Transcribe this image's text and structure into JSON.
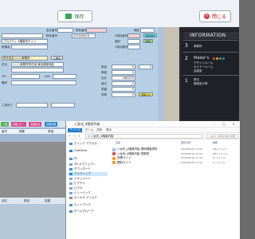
{
  "toolbar": {
    "save_label": "保存",
    "close_label": "閉じる"
  },
  "form": {
    "labels": [
      "会社番号",
      "物件番号",
      "補記",
      "物件番号",
      "3項目番号",
      "補記",
      "3項目番号",
      "現場名",
      "物件名",
      "株式会社○○○事務所",
      "担当",
      "TEL",
      "FAX",
      "備考",
      "工事完了",
      "工事名",
      "見積",
      "合計",
      "数量",
      "単価",
      "値引",
      "税額"
    ],
    "values": {
      "company_code": "",
      "date1": "2020/06/19",
      "property_name": "プロパティ 4階案内サイン",
      "client": "株式会社○○○事務所",
      "person": "山田",
      "address": "○○○事務所所在地 東京都新宿区",
      "amount": "186,870",
      "num1": "0",
      "num2": "0",
      "num3": "0",
      "num4": "0",
      "num5": "0",
      "num6": "0"
    },
    "chips": [
      "表示ON",
      "件名",
      "見積入力"
    ]
  },
  "photo": {
    "header": "INFORMATION",
    "floors": [
      {
        "num": "3",
        "lines": [
          "事務所"
        ]
      },
      {
        "num": "2",
        "lines": [
          "Maker's",
          "デザインルーム",
          "セミナールーム",
          "会議室"
        ]
      },
      {
        "num": "1",
        "lines": [
          "受付",
          "機械室の等"
        ]
      }
    ],
    "swatch_colors": [
      "#e8443a",
      "#f0a02c",
      "#3fae49",
      "#2e7fd0"
    ]
  },
  "sheet": {
    "tabs": [
      {
        "label": "一括",
        "color": "#59b25a"
      },
      {
        "label": "見積コピー",
        "color": "#d64a8e"
      },
      {
        "label": "見積取消",
        "color": "#d64a8e"
      },
      {
        "label": "見積印刷",
        "color": "#2e86c9"
      }
    ],
    "row1": [
      "番号",
      "摘要",
      "単価"
    ],
    "bar": [
      "品名",
      "数量",
      "金額"
    ]
  },
  "explorer": {
    "title": "八女化_4階案内板",
    "ribbon": [
      "ファイル",
      "ホーム",
      "共有",
      "表示"
    ],
    "address": "> 八女化_4階案内板",
    "search": "八女化_4階案内板の検索",
    "columns": [
      "名前",
      "更新日時",
      "種類"
    ],
    "files": [
      {
        "name": "八女化_4階案内板 現地調査資料",
        "date": "2020/06/21 11:06",
        "type": "JPG ファイル",
        "icon": "#9bc2e6"
      },
      {
        "name": "八女化_4階案内板 見積書",
        "date": "2020/06/19 10:54",
        "type": "PDF ファイル",
        "icon": "#d9534f"
      },
      {
        "name": "見積サイン",
        "date": "2020/06/19 11:32",
        "type": "AI ファイル",
        "icon": "#f0a02c"
      },
      {
        "name": "閲覧サイン",
        "date": "2020/06/19 11:52",
        "type": "AI ファイル",
        "icon": "#f0a02c"
      }
    ],
    "nav": [
      {
        "label": "クイック アクセス",
        "color": "#3a8ee6"
      },
      {
        "label": "OneDrive",
        "color": "#2a7bd6"
      },
      {
        "label": "PC",
        "color": "#4a90d9"
      },
      {
        "label": "3D オブジェクト",
        "color": "#6aa7e0"
      },
      {
        "label": "ダウンロード",
        "color": "#3a8ee6"
      },
      {
        "label": "デスクトップ",
        "color": "#2f7fd3",
        "selected": true
      },
      {
        "label": "ドキュメント",
        "color": "#8aa4bf"
      },
      {
        "label": "ピクチャ",
        "color": "#6aa7e0"
      },
      {
        "label": "ビデオ",
        "color": "#6aa7e0"
      },
      {
        "label": "ミュージック",
        "color": "#6aa7e0"
      },
      {
        "label": "ローカル ディスク",
        "color": "#8a8a8a"
      },
      {
        "label": "ネットワーク",
        "color": "#4a90d9"
      },
      {
        "label": "ホームグループ",
        "color": "#4a90d9"
      }
    ]
  }
}
